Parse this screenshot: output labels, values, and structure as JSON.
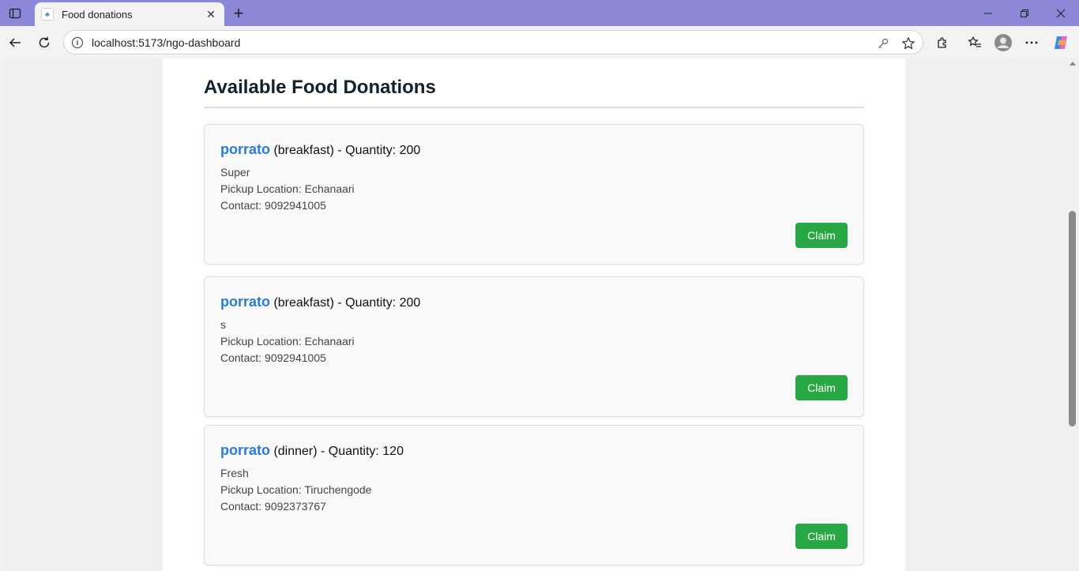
{
  "browser": {
    "tab_title": "Food donations",
    "url": "localhost:5173/ngo-dashboard"
  },
  "page": {
    "title": "Available Food Donations"
  },
  "donations": [
    {
      "name": "porrato",
      "meal_quantity": "(breakfast) - Quantity: 200",
      "description": "Super",
      "pickup": "Pickup Location: Echanaari",
      "contact": "Contact: 9092941005",
      "button": "Claim"
    },
    {
      "name": "porrato",
      "meal_quantity": "(breakfast) - Quantity: 200",
      "description": "s",
      "pickup": "Pickup Location: Echanaari",
      "contact": "Contact: 9092941005",
      "button": "Claim"
    },
    {
      "name": "porrato",
      "meal_quantity": "(dinner) - Quantity: 120",
      "description": "Fresh",
      "pickup": "Pickup Location: Tiruchengode",
      "contact": "Contact: 9092373767",
      "button": "Claim"
    }
  ],
  "colors": {
    "accent_blue": "#2b7bd6",
    "claim_green": "#28a745",
    "titlebar": "#8c88d8"
  }
}
